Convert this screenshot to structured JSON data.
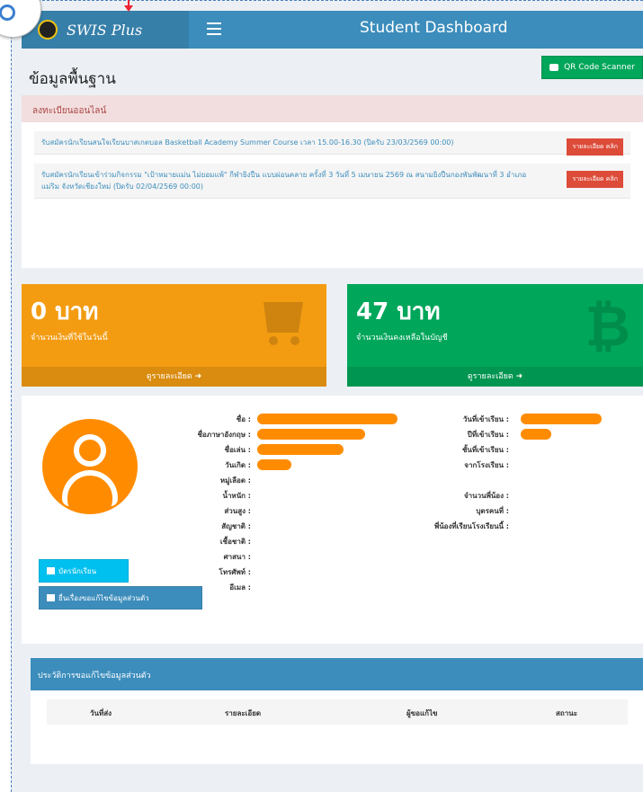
{
  "topbar": {
    "brand": "SWIS Plus",
    "title": "Student Dashboard",
    "theme_color": "#3c8dbc"
  },
  "page": {
    "title": "ข้อมูลพื้นฐาน",
    "qr_button": "QR Code Scanner"
  },
  "registration": {
    "header": "ลงทะเบียนออนไลน์",
    "items": [
      {
        "text": "รับสมัครนักเรียนสนใจเรียนบาสเกตบอล Basketball Academy Summer Course เวลา 15.00-16.30 (ปิดรับ 23/03/2569 00:00)",
        "tag": "รายละเอียด คลิก"
      },
      {
        "text": "รับสมัครนักเรียนเข้าร่วมกิจกรรม \"เป้าหมายแม่น ไม่ยอมแพ้\" กีฬายิงปืน แบบผ่อนคลาย ครั้งที่ 3 วันที่ 5 เมษายน 2569 ณ สนามยิงปืนกองพันพัฒนาที่ 3 อำเภอแม่ริม จังหวัดเชียงใหม่ (ปิดรับ 02/04/2569 00:00)",
        "tag": "รายละเอียด คลิก"
      }
    ]
  },
  "tiles": {
    "today_amount": "0 บาท",
    "today_label": "จำนวนเงินที่ใช้ในวันนี้",
    "today_more": "ดูรายละเอียด",
    "balance_amount": "47 บาท",
    "balance_label": "จำนวนเงินคงเหลือในบัญชี",
    "balance_more": "ดูรายละเอียด"
  },
  "profile": {
    "left_labels": [
      "ชื่อ :",
      "ชื่อภาษาอังกฤษ :",
      "ชื่อเล่น :",
      "วันเกิด :",
      "หมู่เลือด :",
      "น้ำหนัก :",
      "ส่วนสูง :",
      "สัญชาติ :",
      "เชื้อชาติ :",
      "ศาสนา :",
      "โทรศัพท์ :",
      "อีเมล :"
    ],
    "right_labels": [
      "วันที่เข้าเรียน :",
      "ปีที่เข้าเรียน :",
      "ชั้นที่เข้าเรียน :",
      "จากโรงเรียน :",
      "",
      "",
      "จำนวนพี่น้อง :",
      "บุตรคนที่ :",
      "พี่น้องที่เรียนโรงเรียนนี้ :"
    ],
    "student_card_button": "บัตรนักเรียน",
    "edit_request_button": "ยื่นเรื่องขอแก้ไขข้อมูลส่วนตัว"
  },
  "history": {
    "header": "ประวัติการขอแก้ไขข้อมูลส่วนตัว",
    "columns": [
      "วันที่ส่ง",
      "รายละเอียด",
      "ผู้ขอแก้ไข",
      "สถานะ"
    ]
  }
}
